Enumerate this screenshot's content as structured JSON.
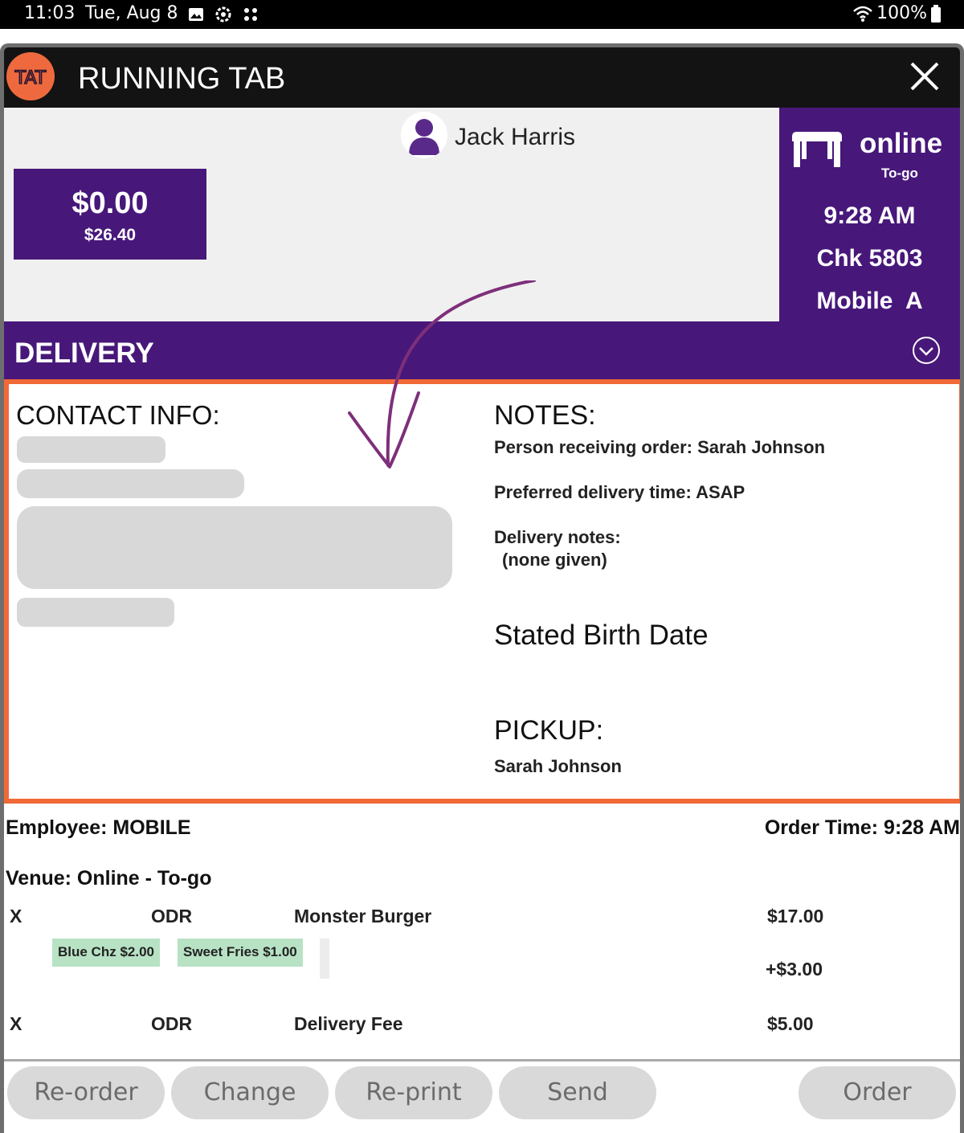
{
  "status_bar": {
    "time": "11:03",
    "date": "Tue, Aug 8",
    "battery": "100%"
  },
  "window": {
    "logo_text": "TAT",
    "title": "RUNNING TAB"
  },
  "customer": {
    "name": "Jack Harris",
    "balance": "$0.00",
    "total": "$26.40"
  },
  "order_info": {
    "source": "online",
    "type": "To-go",
    "time": "9:28 AM",
    "check": "Chk 5803",
    "station": "Mobile  A"
  },
  "delivery": {
    "label": "DELIVERY"
  },
  "contact": {
    "title": "CONTACT INFO:"
  },
  "notes": {
    "title": "NOTES:",
    "receiver": "Person receiving order: Sarah Johnson",
    "preferred_time": "Preferred delivery time: ASAP",
    "delivery_notes_label": "Delivery notes:",
    "delivery_notes_value": "(none given)",
    "birth_date_label": "Stated Birth Date",
    "pickup_title": "PICKUP:",
    "pickup_name": "Sarah Johnson"
  },
  "order": {
    "employee": "Employee: MOBILE",
    "order_time": "Order Time: 9:28 AM",
    "venue": "Venue: Online - To-go",
    "items": [
      {
        "mark": "X",
        "code": "ODR",
        "name": "Monster Burger",
        "price": "$17.00"
      },
      {
        "mark": "X",
        "code": "ODR",
        "name": "Delivery Fee",
        "price": "$5.00"
      }
    ],
    "modifiers": [
      "Blue Chz $2.00",
      "Sweet Fries $1.00"
    ],
    "modifiers_total": "+$3.00"
  },
  "buttons": {
    "reorder": "Re-order",
    "change": "Change",
    "reprint": "Re-print",
    "send": "Send",
    "order": "Order"
  },
  "colors": {
    "brand_purple": "#47187a",
    "highlight_orange": "#f06937",
    "annotation_arrow": "#7e2f7a"
  }
}
